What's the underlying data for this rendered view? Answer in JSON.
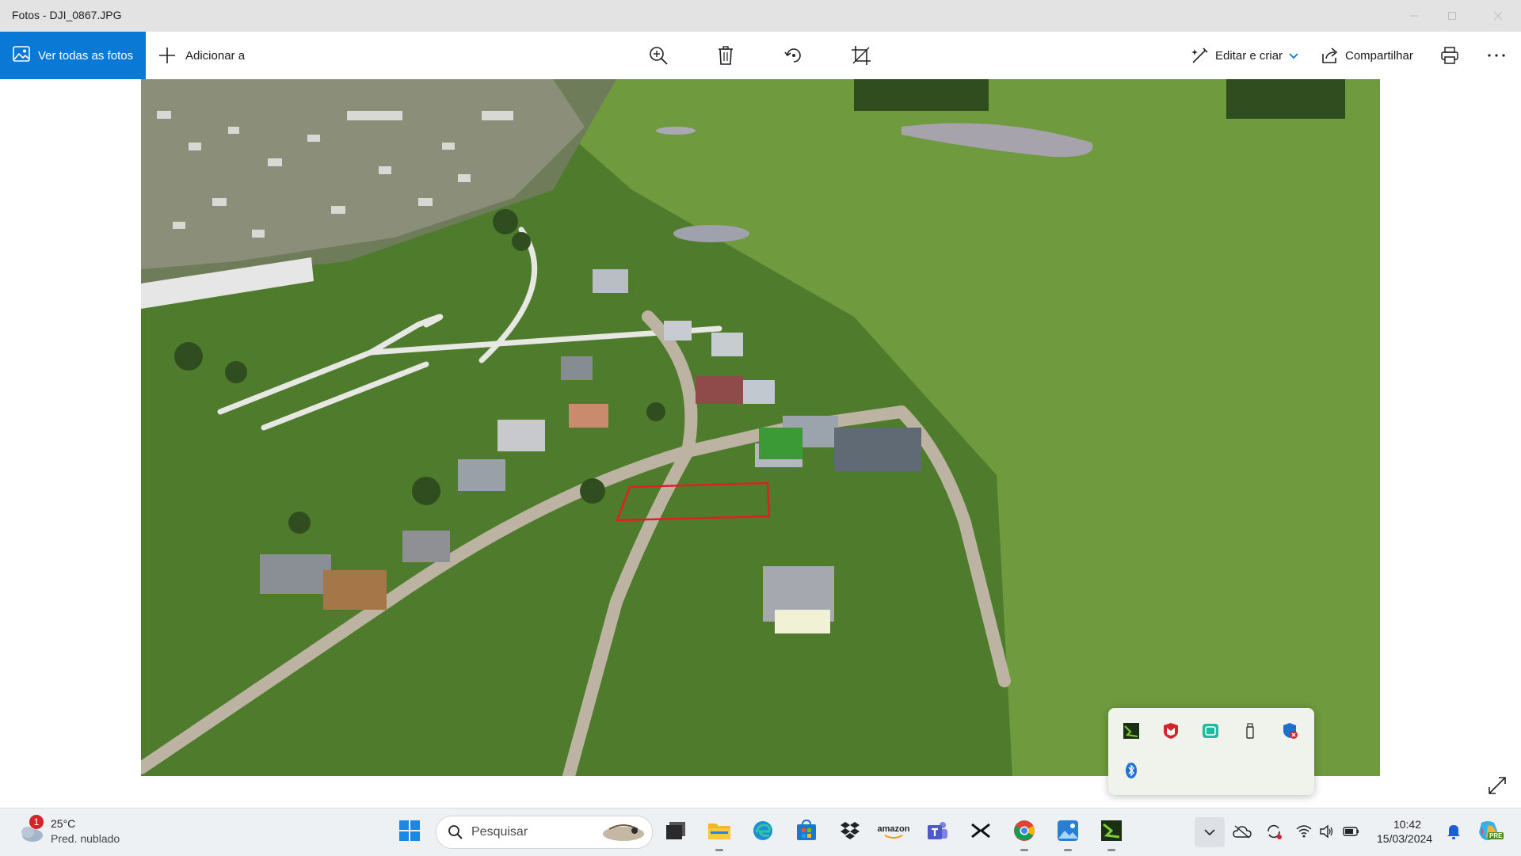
{
  "window": {
    "title": "Fotos - DJI_0867.JPG"
  },
  "toolbar": {
    "view_all_label": "Ver todas as fotos",
    "add_label": "Adicionar a",
    "edit_label": "Editar e criar",
    "share_label": "Compartilhar"
  },
  "taskbar": {
    "weather_temp": "25°C",
    "weather_desc": "Pred. nublado",
    "weather_badge": "1",
    "search_placeholder": "Pesquisar",
    "amazon_label": "amazon",
    "clock_time": "10:42",
    "clock_date": "15/03/2024",
    "copilot_badge": "PRE"
  },
  "colors": {
    "accent": "#0a79d6",
    "selection_rect": "#e02020",
    "titlebar_bg": "#e3e3e3",
    "taskbar_bg": "#eef1f3"
  }
}
